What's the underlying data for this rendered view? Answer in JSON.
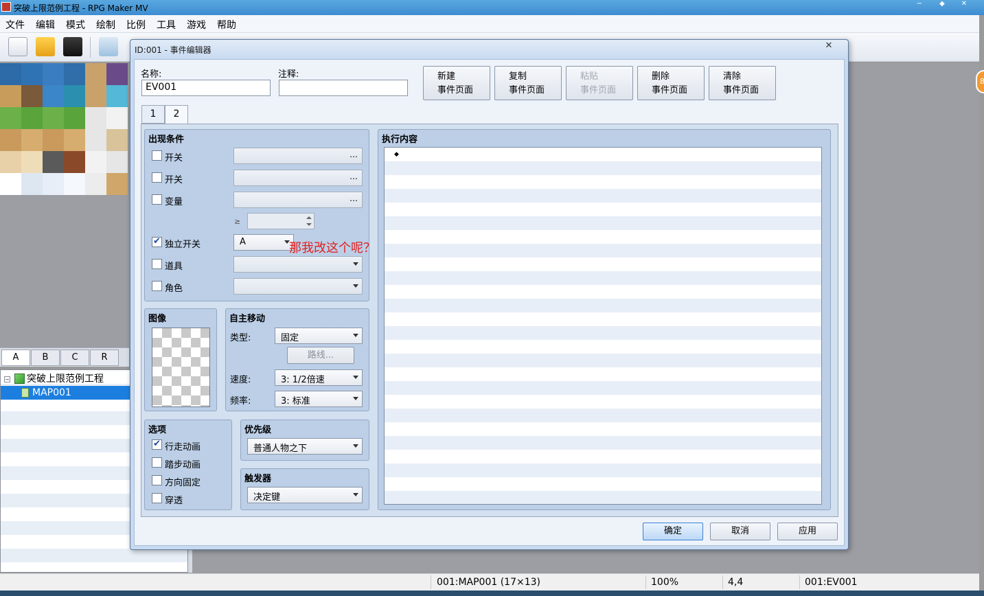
{
  "window": {
    "title": "突破上限范例工程 - RPG Maker MV",
    "min": "−",
    "max": "◆",
    "close": "✕"
  },
  "menu": [
    "文件",
    "编辑",
    "模式",
    "绘制",
    "比例",
    "工具",
    "游戏",
    "帮助"
  ],
  "toolbar_icons": [
    "new-project-icon",
    "open-project-icon",
    "save-icon",
    "cut-icon",
    "copy-icon",
    "paste-icon",
    "map-layer-icon",
    "event-layer-icon",
    "pencil-icon",
    "rectangle-icon",
    "ellipse-icon",
    "fill-icon",
    "shadow-pen-icon",
    "zoom-in-icon",
    "zoom-out-icon",
    "zoom-reset-icon",
    "database-icon",
    "plugin-icon",
    "sound-icon",
    "event-searcher-icon",
    "resource-manager-icon",
    "character-generator-icon",
    "playtest-icon"
  ],
  "tileset_tabs": [
    "A",
    "B",
    "C",
    "R"
  ],
  "map_tree": {
    "project": "突破上限范例工程",
    "map": "MAP001"
  },
  "status_bar": {
    "map": "001:MAP001 (17×13)",
    "zoom": "100%",
    "coord": "4,4",
    "event": "001:EV001"
  },
  "badge": "8",
  "dialog": {
    "title": "ID:001 - 事件编辑器",
    "close": "✕",
    "name_label": "名称:",
    "name_value": "EV001",
    "note_label": "注释:",
    "note_value": "",
    "page_buttons": [
      {
        "line1": "新建",
        "line2": "事件页面",
        "enabled": true
      },
      {
        "line1": "复制",
        "line2": "事件页面",
        "enabled": true
      },
      {
        "line1": "粘贴",
        "line2": "事件页面",
        "enabled": false
      },
      {
        "line1": "删除",
        "line2": "事件页面",
        "enabled": true
      },
      {
        "line1": "清除",
        "line2": "事件页面",
        "enabled": true
      }
    ],
    "page_tabs": [
      "1",
      "2"
    ],
    "active_tab": "2",
    "conditions": {
      "title": "出现条件",
      "switch1_label": "开关",
      "switch2_label": "开关",
      "variable_label": "变量",
      "ge_symbol": "≥",
      "self_switch_label": "独立开关",
      "self_switch_value": "A",
      "item_label": "道具",
      "actor_label": "角色",
      "ellipsis": "…",
      "self_switch_checked": true
    },
    "annotation": "那我改这个呢？",
    "image": {
      "title": "图像"
    },
    "autonomous": {
      "title": "自主移动",
      "type_label": "类型:",
      "type_value": "固定",
      "route_button": "路线...",
      "speed_label": "速度:",
      "speed_value": "3: 1/2倍速",
      "freq_label": "频率:",
      "freq_value": "3: 标准"
    },
    "options": {
      "title": "选项",
      "walking": "行走动画",
      "stepping": "踏步动画",
      "direction_fix": "方向固定",
      "through": "穿透",
      "walking_checked": true
    },
    "priority": {
      "title": "优先级",
      "value": "普通人物之下"
    },
    "trigger": {
      "title": "触发器",
      "value": "决定键"
    },
    "contents": {
      "title": "执行内容",
      "marker": "◆"
    },
    "ok": "确定",
    "cancel": "取消",
    "apply": "应用"
  },
  "colors": {
    "accent": "#1c7fe0",
    "annotation": "#e02020",
    "dialog_bg": "#c8daf0"
  }
}
